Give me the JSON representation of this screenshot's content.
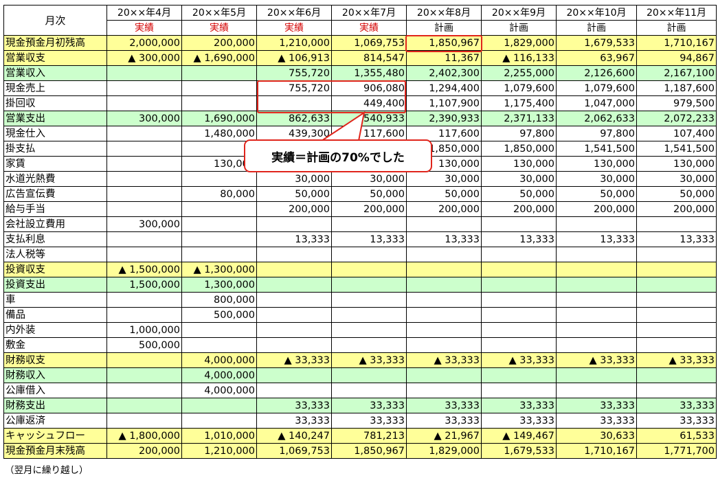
{
  "corner_label": "月次",
  "months": [
    "20××年4月",
    "20××年5月",
    "20××年6月",
    "20××年7月",
    "20××年8月",
    "20××年9月",
    "20××年10月",
    "20××年11月"
  ],
  "kinds": [
    "実績",
    "実績",
    "実績",
    "実績",
    "計画",
    "計画",
    "計画",
    "計画"
  ],
  "rows": [
    {
      "label": "現金預金月初残高",
      "style": "yellow",
      "values": [
        "2,000,000",
        "200,000",
        "1,210,000",
        "1,069,753",
        "1,850,967",
        "1,829,000",
        "1,679,533",
        "1,710,167"
      ]
    },
    {
      "label": "営業収支",
      "style": "yellow",
      "values": [
        "▲ 300,000",
        "▲ 1,690,000",
        "▲ 106,913",
        "814,547",
        "11,367",
        "▲ 116,133",
        "63,967",
        "94,867"
      ]
    },
    {
      "label": "営業収入",
      "style": "green",
      "values": [
        "",
        "",
        "755,720",
        "1,355,480",
        "2,402,300",
        "2,255,000",
        "2,126,600",
        "2,167,100"
      ]
    },
    {
      "label": "現金売上",
      "style": "",
      "values": [
        "",
        "",
        "755,720",
        "906,080",
        "1,294,400",
        "1,079,600",
        "1,079,600",
        "1,187,600"
      ]
    },
    {
      "label": "掛回収",
      "style": "",
      "values": [
        "",
        "",
        "",
        "449,400",
        "1,107,900",
        "1,175,400",
        "1,047,000",
        "979,500"
      ]
    },
    {
      "label": "営業支出",
      "style": "green",
      "values": [
        "300,000",
        "1,690,000",
        "862,633",
        "540,933",
        "2,390,933",
        "2,371,133",
        "2,062,633",
        "2,072,233"
      ]
    },
    {
      "label": "現金仕入",
      "style": "",
      "values": [
        "",
        "1,480,000",
        "439,300",
        "117,600",
        "117,600",
        "97,800",
        "97,800",
        "107,400"
      ]
    },
    {
      "label": "掛支払",
      "style": "",
      "values": [
        "",
        "",
        "",
        "",
        "1,850,000",
        "1,850,000",
        "1,541,500",
        "1,541,500"
      ]
    },
    {
      "label": "家賃",
      "style": "",
      "values": [
        "",
        "130,000",
        "",
        "",
        "130,000",
        "130,000",
        "130,000",
        "130,000"
      ]
    },
    {
      "label": "水道光熱費",
      "style": "",
      "values": [
        "",
        "",
        "30,000",
        "30,000",
        "30,000",
        "30,000",
        "30,000",
        "30,000"
      ]
    },
    {
      "label": "広告宣伝費",
      "style": "",
      "values": [
        "",
        "80,000",
        "50,000",
        "50,000",
        "50,000",
        "50,000",
        "50,000",
        "50,000"
      ]
    },
    {
      "label": "給与手当",
      "style": "",
      "values": [
        "",
        "",
        "200,000",
        "200,000",
        "200,000",
        "200,000",
        "200,000",
        "200,000"
      ]
    },
    {
      "label": "会社設立費用",
      "style": "",
      "values": [
        "300,000",
        "",
        "",
        "",
        "",
        "",
        "",
        ""
      ]
    },
    {
      "label": "支払利息",
      "style": "",
      "values": [
        "",
        "",
        "13,333",
        "13,333",
        "13,333",
        "13,333",
        "13,333",
        "13,333"
      ]
    },
    {
      "label": "法人税等",
      "style": "",
      "values": [
        "",
        "",
        "",
        "",
        "",
        "",
        "",
        ""
      ]
    },
    {
      "label": "投資収支",
      "style": "yellow",
      "values": [
        "▲ 1,500,000",
        "▲ 1,300,000",
        "",
        "",
        "",
        "",
        "",
        ""
      ]
    },
    {
      "label": "投資支出",
      "style": "green",
      "values": [
        "1,500,000",
        "1,300,000",
        "",
        "",
        "",
        "",
        "",
        ""
      ]
    },
    {
      "label": "車",
      "style": "",
      "values": [
        "",
        "800,000",
        "",
        "",
        "",
        "",
        "",
        ""
      ]
    },
    {
      "label": "備品",
      "style": "",
      "values": [
        "",
        "500,000",
        "",
        "",
        "",
        "",
        "",
        ""
      ]
    },
    {
      "label": "内外装",
      "style": "",
      "values": [
        "1,000,000",
        "",
        "",
        "",
        "",
        "",
        "",
        ""
      ]
    },
    {
      "label": "敷金",
      "style": "",
      "values": [
        "500,000",
        "",
        "",
        "",
        "",
        "",
        "",
        ""
      ]
    },
    {
      "label": "財務収支",
      "style": "yellow",
      "values": [
        "",
        "4,000,000",
        "▲ 33,333",
        "▲ 33,333",
        "▲ 33,333",
        "▲ 33,333",
        "▲ 33,333",
        "▲ 33,333"
      ]
    },
    {
      "label": "財務収入",
      "style": "green",
      "values": [
        "",
        "4,000,000",
        "",
        "",
        "",
        "",
        "",
        ""
      ]
    },
    {
      "label": "公庫借入",
      "style": "",
      "values": [
        "",
        "4,000,000",
        "",
        "",
        "",
        "",
        "",
        ""
      ]
    },
    {
      "label": "財務支出",
      "style": "green",
      "values": [
        "",
        "",
        "33,333",
        "33,333",
        "33,333",
        "33,333",
        "33,333",
        "33,333"
      ]
    },
    {
      "label": "公庫返済",
      "style": "",
      "values": [
        "",
        "",
        "33,333",
        "33,333",
        "33,333",
        "33,333",
        "33,333",
        "33,333"
      ]
    },
    {
      "label": "キャッシュフロー",
      "style": "yellow",
      "values": [
        "▲ 1,800,000",
        "1,010,000",
        "▲ 140,247",
        "781,213",
        "▲ 21,967",
        "▲ 149,467",
        "30,633",
        "61,533"
      ]
    },
    {
      "label": "現金預金月末残高",
      "style": "yellow",
      "values": [
        "200,000",
        "1,210,000",
        "1,069,753",
        "1,850,967",
        "1,829,000",
        "1,679,533",
        "1,710,167",
        "1,771,700"
      ]
    }
  ],
  "footnote": "（翌月に繰り越し）",
  "callout_text": "実績＝計画の70%でした",
  "colors": {
    "yellow": "#ffff99",
    "green": "#ccffcc",
    "actual_red": "#d40000",
    "highlight": "#e0241b"
  }
}
